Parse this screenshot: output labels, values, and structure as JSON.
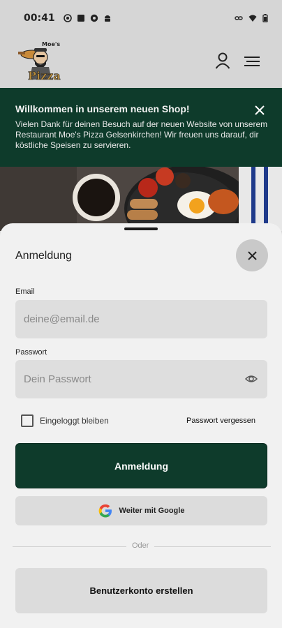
{
  "status_bar": {
    "time": "00:41"
  },
  "header": {
    "logo_name": "moes-pizza-logo"
  },
  "banner": {
    "title": "Willkommen in unserem neuen Shop!",
    "text": "Vielen Dank für deinen Besuch auf der neuen Website von unserem Restaurant Moe's Pizza Gelsenkirchen! Wir freuen uns darauf, dir köstliche Speisen zu servieren."
  },
  "login": {
    "title": "Anmeldung",
    "email_label": "Email",
    "email_placeholder": "deine@email.de",
    "password_label": "Passwort",
    "password_placeholder": "Dein Passwort",
    "remember_label": "Eingeloggt bleiben",
    "forgot_label": "Passwort vergessen",
    "submit_label": "Anmeldung",
    "google_label": "Weiter mit Google",
    "divider_label": "Oder",
    "register_label": "Benutzerkonto erstellen"
  },
  "colors": {
    "brand_green": "#0e3b2b",
    "sheet_bg": "#f1f1f1"
  }
}
